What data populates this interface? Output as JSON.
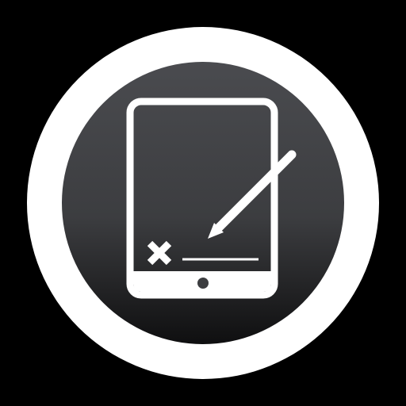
{
  "icon": {
    "name": "tablet-signature-icon",
    "colors": {
      "background": "#000000",
      "ring": "#ffffff",
      "disc_top": "#4a4b4f",
      "disc_bottom": "#0f0f10",
      "glyph": "#ffffff"
    },
    "elements": [
      "white-ring",
      "dark-disc",
      "tablet-icon",
      "pencil-icon",
      "x-mark-icon",
      "signature-line",
      "home-button-icon"
    ]
  }
}
